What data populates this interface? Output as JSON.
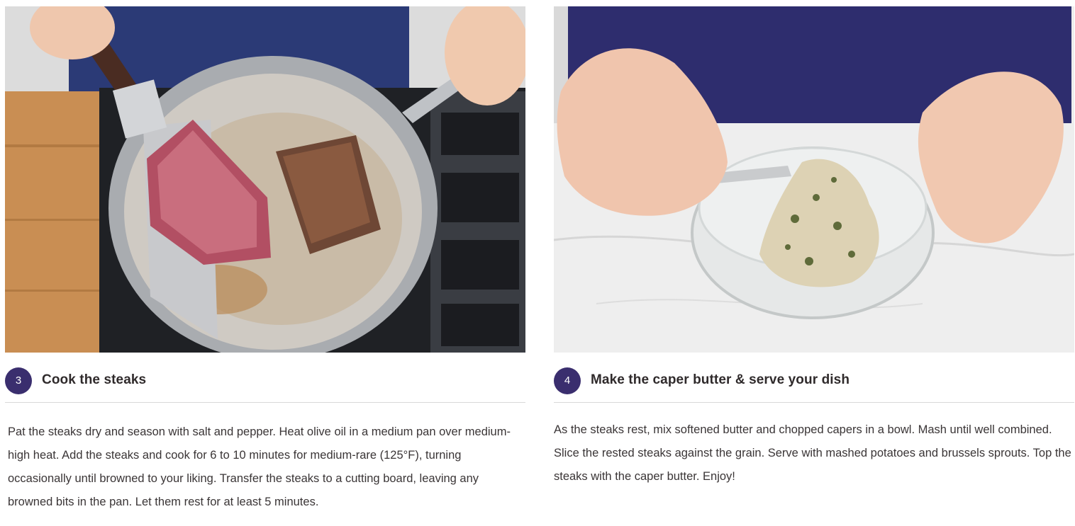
{
  "steps": [
    {
      "number": "3",
      "title": "Cook the steaks",
      "body": "Pat the steaks dry and season with salt and pepper. Heat olive oil in a medium pan over medium-high heat. Add the steaks and cook for 6 to 10 minutes for medium-rare (125°F), turning occasionally until browned to your liking. Transfer the steaks to a cutting board, leaving any browned bits in the pan. Let them rest for at least 5 minutes.",
      "image": "steaks-in-pan-photo"
    },
    {
      "number": "4",
      "title": "Make the caper butter & serve your dish",
      "body": "As the steaks rest, mix softened butter and chopped capers in a bowl. Mash until well combined. Slice the rested steaks against the grain. Serve with mashed potatoes and brussels sprouts. Top the steaks with the caper butter. Enjoy!",
      "image": "caper-butter-bowl-photo"
    }
  ],
  "colors": {
    "accent": "#3a2e6e",
    "text": "#2f2a2b",
    "divider": "#d9d9d9"
  }
}
